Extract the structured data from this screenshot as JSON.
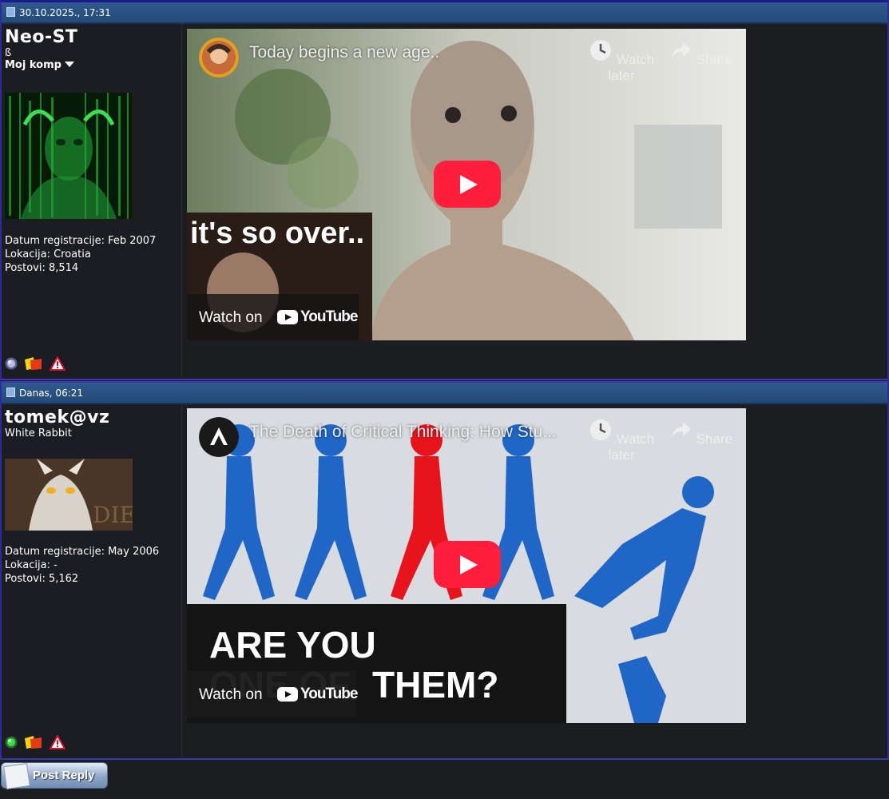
{
  "posts": [
    {
      "timestamp": "30.10.2025., 17:31",
      "username": "Neo-ST",
      "user_title": "ß",
      "moj_komp": "Moj komp",
      "stats": {
        "registration": "Datum registracije: Feb 2007",
        "location": "Lokacija: Croatia",
        "posts": "Postovi: 8,514"
      },
      "status_color": "#7f86b8",
      "video": {
        "title": "Today begins a new age..",
        "watch_later": "Watch later",
        "share": "Share",
        "watch_on": "Watch on",
        "youtube": "YouTube",
        "thumb_caption": "it's so over.."
      }
    },
    {
      "timestamp": "Danas, 06:21",
      "username": "tomek@vz",
      "user_title": "White Rabbit",
      "stats": {
        "registration": "Datum registracije: May 2006",
        "location": "Lokacija: -",
        "posts": "Postovi: 5,162"
      },
      "status_color": "#22c42a",
      "video": {
        "title": "The Death of Critical Thinking: How Stu...",
        "watch_later": "Watch later",
        "share": "Share",
        "watch_on": "Watch on",
        "youtube": "YouTube",
        "thumb_line1": "ARE YOU",
        "thumb_line2": "ONE OF",
        "thumb_line3": "THEM?",
        "avatar_overlay_text": "DIE"
      }
    }
  ],
  "reply_button": "Post Reply",
  "colors": {
    "header": "#2a5283",
    "accent_red": "#ff1f3c",
    "figure_blue": "#1f66c6"
  }
}
